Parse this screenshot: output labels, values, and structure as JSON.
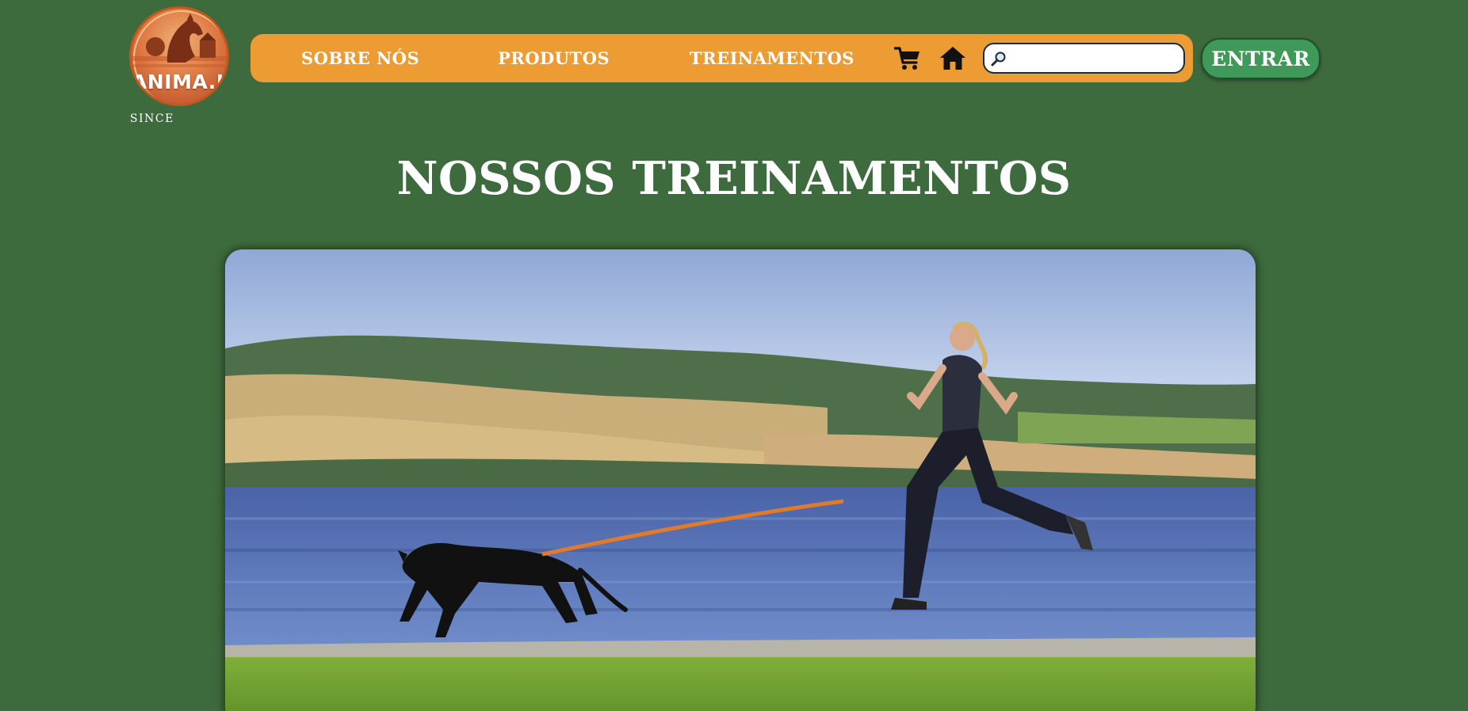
{
  "brand": {
    "name": "ANIMA.IA",
    "since": "SINCE"
  },
  "nav": {
    "items": [
      {
        "label": "SOBRE NÓS"
      },
      {
        "label": "PRODUTOS"
      },
      {
        "label": "TREINAMENTOS"
      }
    ],
    "icons": [
      "cart-icon",
      "home-icon",
      "search-icon"
    ]
  },
  "search": {
    "value": "",
    "placeholder": ""
  },
  "login": {
    "label": "ENTRAR"
  },
  "main": {
    "title": "NOSSOS TREINAMENTOS"
  },
  "colors": {
    "background": "#3d6b3d",
    "navbar": "#ed9b33",
    "login_button": "#3f9a5a",
    "text": "#ffffff"
  }
}
